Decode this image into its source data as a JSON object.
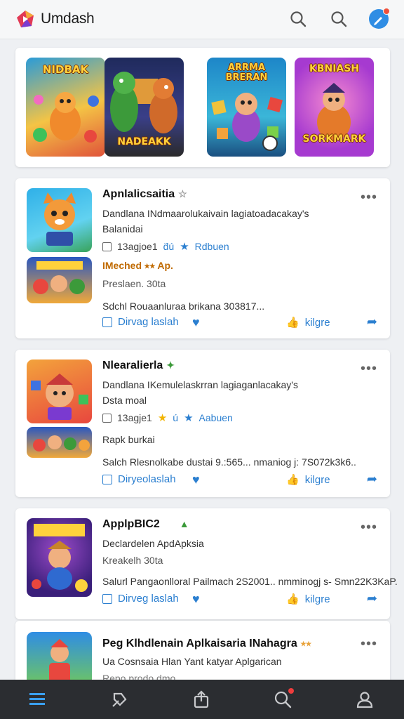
{
  "app": {
    "title": "Umdash"
  },
  "featured": [
    {
      "label": "NIDBAK",
      "colors": [
        "#2a9bd8",
        "#f4c445",
        "#e0533a"
      ]
    },
    {
      "label": "NADEAKK",
      "colors": [
        "#1f2a5c",
        "#3c8a3a",
        "#d68a2e"
      ]
    },
    {
      "label": "ARRMA BRERAN",
      "colors": [
        "#1d86c8",
        "#3bb6d8",
        "#f0a83a"
      ]
    },
    {
      "label": "KBNIASH",
      "sublabel": "SORKMARK",
      "colors": [
        "#a63ad0",
        "#e64ba0",
        "#f3a33c"
      ]
    }
  ],
  "posts": [
    {
      "title": "Apnlalicsaitia",
      "badge": "☆",
      "desc": "Dandlana INdmaarolukaivain lagiatoadacakay's",
      "sub": "Balanidai",
      "meta": {
        "date": "13agjoe1",
        "tag1": "d̈ú",
        "tag2": "Rdbuen"
      },
      "extra_line": "IMeched ⭑⭑ Ap.",
      "extra_sub": "Preslaen. 30ta",
      "summary": "Sdchl Rouaanluraa brikana 303817...",
      "actions": {
        "left": "Dirvag laslah",
        "reshare": "kilgre"
      }
    },
    {
      "title": "Nlearalierla",
      "badge": "✦",
      "desc": "Dandlana IKemulelaskrran lagiaganlacakay's",
      "sub": "Dsta moal",
      "meta": {
        "date": "13agje1",
        "tag1": "ú",
        "tag2": "Aabuen"
      },
      "extra_line": "Rapk burkai",
      "summary": "Salch Rlesnolkabe dustai 9.:565...  nmaniog j: 7S072k3k6..",
      "actions": {
        "left": "Diryeolaslah",
        "reshare": "kilgre"
      }
    },
    {
      "title": "ApplpBIC2",
      "badge": "▲",
      "desc": "Declardelen ApdApksia",
      "sub": "Kreakelh 30ta",
      "summary": "Salurl Pangaonlloral Pailmach 2S2001..  nmminogj s- Smn22K3KaP.",
      "actions": {
        "left": "Dirveg laslah",
        "reshare": "kilgre"
      }
    },
    {
      "title": "Peg Klhdlenain Aplkaisaria INahagra",
      "badge": "⭑⭑",
      "desc": "Ua Cosnsaia Hlan Yant katyar Aplgarican",
      "sub": "Repo prodo dmo"
    }
  ],
  "nav": [
    "menu-icon",
    "explore-icon",
    "share-icon",
    "search-icon",
    "profile-icon"
  ],
  "colors": {
    "accent": "#2b7fd0",
    "topbar": "#f6f7f8",
    "bottombar": "#2b2d31"
  }
}
